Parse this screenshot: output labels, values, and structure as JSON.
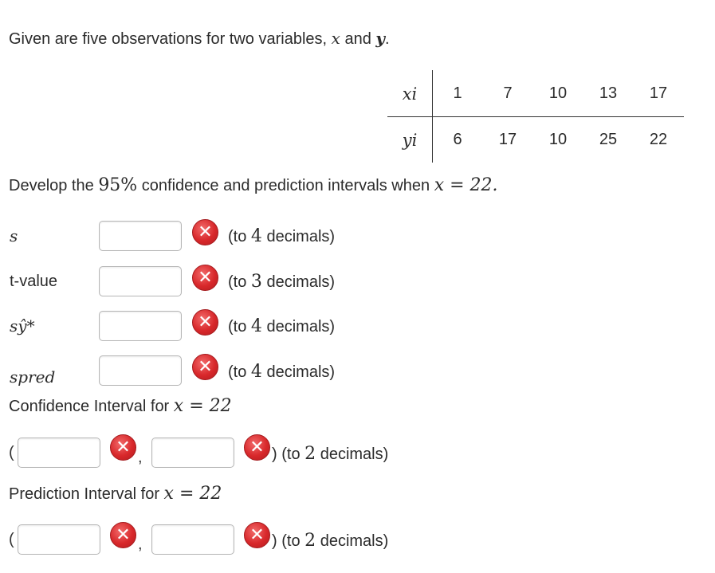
{
  "intro": {
    "text_before": "Given are five observations for two variables,",
    "var_x": "x",
    "text_and": "and",
    "var_y": "y",
    "text_period": "."
  },
  "table": {
    "x_label": "xi",
    "y_label": "yi",
    "x_values": [
      "1",
      "7",
      "10",
      "13",
      "17"
    ],
    "y_values": [
      "6",
      "17",
      "10",
      "25",
      "22"
    ]
  },
  "task": {
    "text_before": "Develop the",
    "confidence": "95%",
    "text_after": "confidence and prediction intervals when",
    "equation": "x = 22."
  },
  "fields": [
    {
      "label": "s",
      "hint_prefix": "(to",
      "decimals": "4",
      "hint_suffix": "decimals)",
      "value": ""
    },
    {
      "label": "t-value",
      "hint_prefix": "(to",
      "decimals": "3",
      "hint_suffix": "decimals)",
      "value": ""
    },
    {
      "label": "sŷ*",
      "hint_prefix": "(to",
      "decimals": "4",
      "hint_suffix": "decimals)",
      "value": ""
    },
    {
      "label": "spred",
      "hint_prefix": "(to",
      "decimals": "4",
      "hint_suffix": "decimals)",
      "value": ""
    }
  ],
  "confidence_interval": {
    "heading": "Confidence Interval for",
    "equation": "x = 22",
    "lower": "",
    "upper": "",
    "hint_prefix": "(to",
    "decimals": "2",
    "hint_suffix": "decimals)"
  },
  "prediction_interval": {
    "heading": "Prediction Interval for",
    "equation": "x = 22",
    "lower": "",
    "upper": "",
    "hint_prefix": "(to",
    "decimals": "2",
    "hint_suffix": "decimals)"
  },
  "status_icon": "incorrect-x-icon",
  "colors": {
    "incorrect": "#d8282b",
    "text": "#2b2b2b"
  }
}
